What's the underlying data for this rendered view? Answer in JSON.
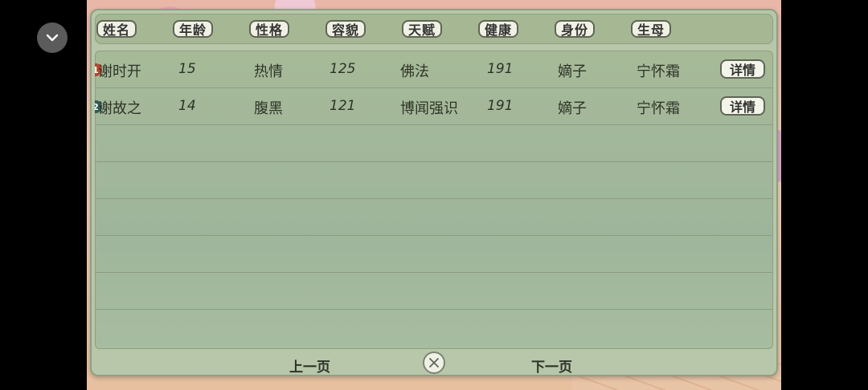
{
  "headers": [
    "姓名",
    "年龄",
    "性格",
    "容貌",
    "天赋",
    "健康",
    "身份",
    "生母"
  ],
  "rows": [
    {
      "index": "1",
      "name": "谢时开",
      "age": "15",
      "personality": "热情",
      "appearance": "125",
      "talent": "佛法",
      "health": "191",
      "status": "嫡子",
      "mother": "宁怀霜",
      "detail": "详情",
      "badge_color": "#b4472b"
    },
    {
      "index": "2",
      "name": "谢故之",
      "age": "14",
      "personality": "腹黑",
      "appearance": "121",
      "talent": "博闻强识",
      "health": "191",
      "status": "嫡子",
      "mother": "宁怀霜",
      "detail": "详情",
      "badge_color": "#2d5d52"
    }
  ],
  "pager": {
    "prev": "上一页",
    "next": "下一页"
  },
  "icons": {
    "toggle": "chevron-down-icon",
    "close": "close-icon"
  }
}
